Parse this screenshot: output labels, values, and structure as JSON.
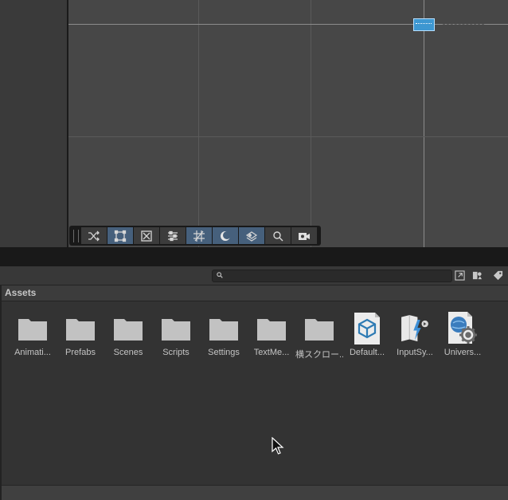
{
  "project": {
    "search": {
      "value": "",
      "placeholder": ""
    },
    "breadcrumb": "Assets",
    "assets": [
      {
        "label": "Animati...",
        "icon": "folder-icon"
      },
      {
        "label": "Prefabs",
        "icon": "folder-icon"
      },
      {
        "label": "Scenes",
        "icon": "folder-icon"
      },
      {
        "label": "Scripts",
        "icon": "folder-icon"
      },
      {
        "label": "Settings",
        "icon": "folder-icon"
      },
      {
        "label": "TextMe...",
        "icon": "folder-icon"
      },
      {
        "label": "横スクロー...",
        "icon": "folder-icon"
      },
      {
        "label": "Default...",
        "icon": "package-cube-icon"
      },
      {
        "label": "InputSy...",
        "icon": "input-system-asset-icon"
      },
      {
        "label": "Univers...",
        "icon": "render-pipeline-asset-icon"
      }
    ]
  },
  "scene_toolbar": {
    "buttons": [
      {
        "name": "shuffle-icon",
        "active": false
      },
      {
        "name": "rect-tool-icon",
        "active": true
      },
      {
        "name": "scale-tool-icon",
        "active": false
      },
      {
        "name": "sliders-icon",
        "active": false
      },
      {
        "name": "grid-snap-icon",
        "active": true
      },
      {
        "name": "shading-mode-icon",
        "active": true
      },
      {
        "name": "layers-icon",
        "active": true
      },
      {
        "name": "search-icon",
        "active": false
      },
      {
        "name": "camera-icon",
        "active": false
      }
    ]
  },
  "colors": {
    "accent_active": "#46607c",
    "scene_object": "#3d97d1"
  }
}
